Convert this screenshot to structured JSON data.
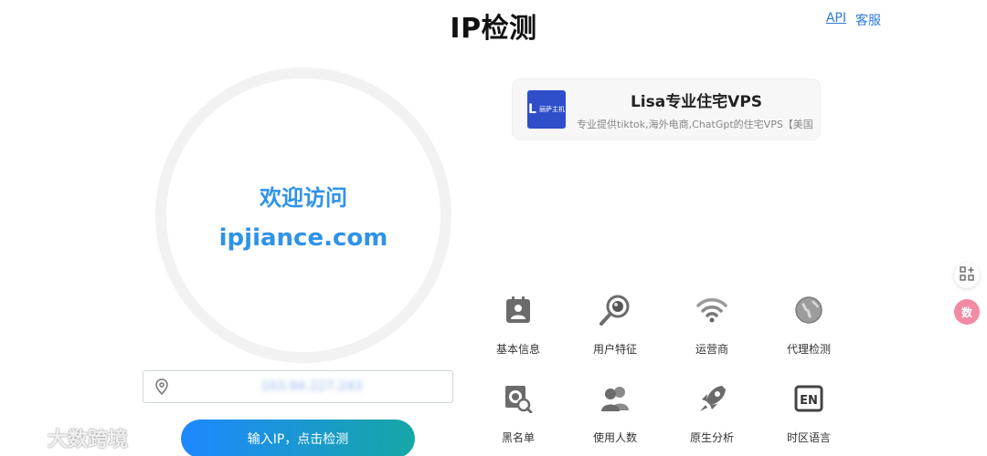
{
  "header": {
    "title": "IP检测",
    "api_link": "API",
    "service_link": "客服"
  },
  "welcome": {
    "line1": "欢迎访问",
    "line2": "ipjiance.com"
  },
  "search": {
    "ip_value": "103.94.227.243",
    "button_label": "输入IP，点击检测"
  },
  "ad": {
    "logo_text": "丽萨主机",
    "title": "Lisa专业住宅VPS",
    "description": "专业提供tiktok,海外电商,ChatGpt的住宅VPS【美国"
  },
  "features": [
    {
      "label": "基本信息",
      "icon": "id-card-icon"
    },
    {
      "label": "用户特征",
      "icon": "magnifier-icon"
    },
    {
      "label": "运营商",
      "icon": "wifi-icon"
    },
    {
      "label": "代理检测",
      "icon": "globe-icon"
    },
    {
      "label": "黑名单",
      "icon": "blacklist-search-icon"
    },
    {
      "label": "使用人数",
      "icon": "users-icon"
    },
    {
      "label": "原生分析",
      "icon": "rocket-icon"
    },
    {
      "label": "时区语言",
      "icon": "en-language-icon"
    }
  ],
  "floating": {
    "pink_label": "数"
  },
  "watermark": {
    "text": "大数跨境"
  },
  "colors": {
    "accent": "#2f93e8",
    "button_start": "#1e88ff",
    "button_end": "#16a7a6",
    "icon_gray": "#6b6b6b"
  }
}
